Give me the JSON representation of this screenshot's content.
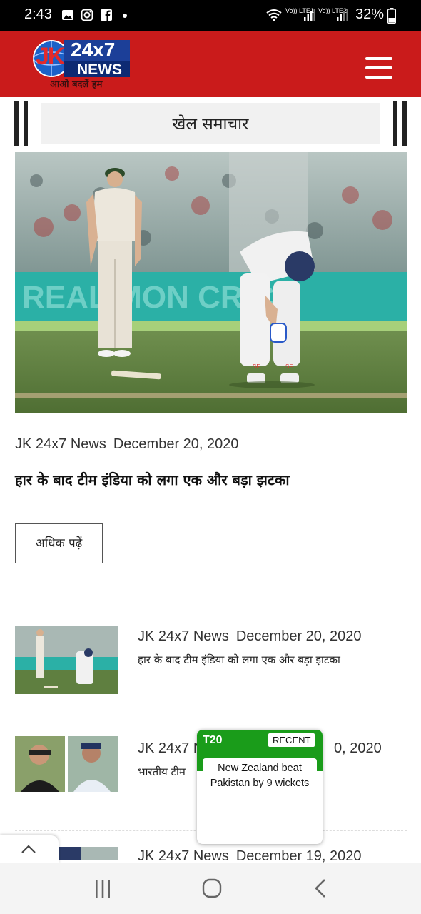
{
  "status_bar": {
    "time": "2:43",
    "battery": "32%",
    "sim1": "Vo)) LTE1",
    "sim2": "Vo)) LTE2"
  },
  "header": {
    "logo_text_jk": "JK",
    "logo_text_24x7": "24x7",
    "logo_text_news": "NEWS",
    "tagline": "आओ बदलें हम",
    "brand_color": "#ca1b1b",
    "menu_icon": "hamburger-icon"
  },
  "section": {
    "title": "खेल समाचार"
  },
  "featured": {
    "author": "JK 24x7 News",
    "date": "December 20, 2020",
    "title": "हार के बाद टीम इंडिया को लगा एक और बड़ा झटका",
    "read_more": "अधिक पढ़ें"
  },
  "list": [
    {
      "author": "JK 24x7 News",
      "date": "December 20, 2020",
      "title": "हार के बाद टीम इंडिया को लगा एक और बड़ा झटका"
    },
    {
      "author": "JK 24x7 N",
      "date": "0, 2020",
      "title": "भारतीय टीम"
    },
    {
      "author": "JK 24x7 News",
      "date": "December 19, 2020"
    }
  ],
  "t20_widget": {
    "tag": "T20",
    "badge": "RECENT",
    "message": "New Zealand beat Pakistan by 9 wickets",
    "accent_color": "#1a9c1a"
  },
  "scroll_top_icon": "chevron-up-icon",
  "nav": {
    "recents_icon": "recents-icon",
    "home_icon": "home-icon",
    "back_icon": "back-icon"
  }
}
